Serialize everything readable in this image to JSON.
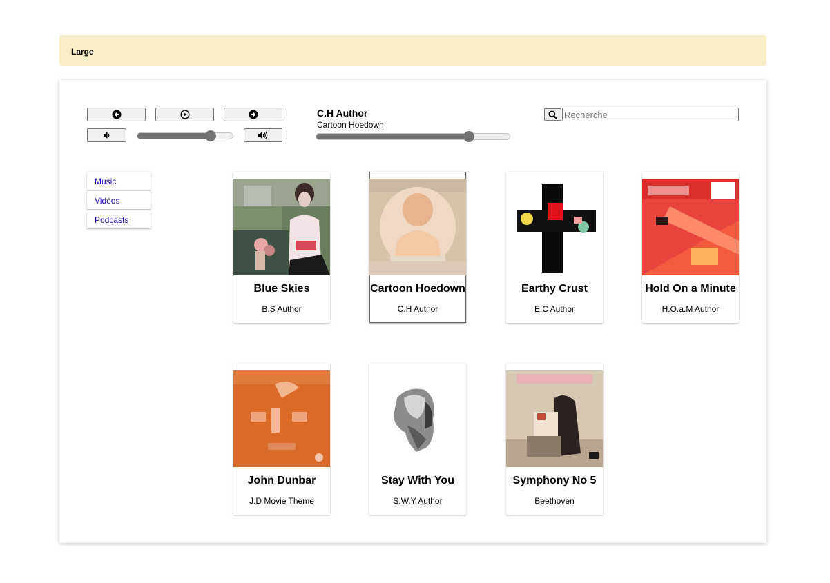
{
  "banner": {
    "label": "Large"
  },
  "player": {
    "prev_icon": "arrow-left-icon",
    "play_icon": "play-icon",
    "next_icon": "arrow-right-icon",
    "vol_down_icon": "volume-low-icon",
    "vol_up_icon": "volume-high-icon",
    "volume_level": 0.77,
    "progress_level": 0.79,
    "now_playing_author": "C.H Author",
    "now_playing_title": "Cartoon Hoedown"
  },
  "search": {
    "icon": "search-icon",
    "placeholder": "Recherche",
    "value": ""
  },
  "nav": {
    "items": [
      {
        "label": "Music"
      },
      {
        "label": "Vidéos"
      },
      {
        "label": "Podcasts"
      }
    ]
  },
  "cards": [
    {
      "title": "Blue Skies",
      "author": "B.S Author"
    },
    {
      "title": "Cartoon Hoedown",
      "author": "C.H Author",
      "selected": true
    },
    {
      "title": "Earthy Crust",
      "author": "E.C Author"
    },
    {
      "title": "Hold On a Minute",
      "author": "H.O.a.M Author"
    },
    {
      "title": "John Dunbar",
      "author": "J.D Movie Theme"
    },
    {
      "title": "Stay With You",
      "author": "S.W.Y Author"
    },
    {
      "title": "Symphony No 5",
      "author": "Beethoven"
    }
  ],
  "colors": {
    "banner_bg": "#f9efc7",
    "link": "#1a0dab",
    "slider_fill": "#737373"
  }
}
